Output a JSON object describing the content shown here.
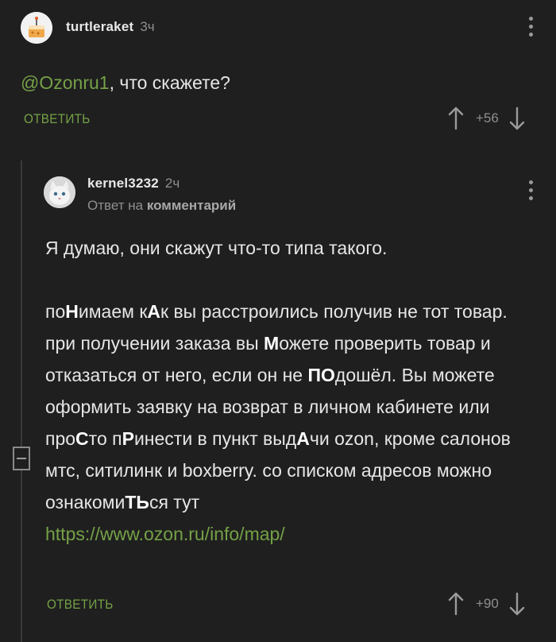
{
  "comment1": {
    "username": "turtleraket",
    "time": "3ч",
    "mention": "@Ozonru1",
    "text": ", что скажете?",
    "reply_label": "ОТВЕТИТЬ",
    "score": "+56",
    "avatar_icon": "cake-icon"
  },
  "comment2": {
    "username": "kernel3232",
    "time": "2ч",
    "reply_prefix": "Ответ на",
    "reply_target": "комментарий",
    "line1": "Я думаю, они скажут что-то типа такого.",
    "link": "https://www.ozon.ru/info/map/",
    "reply_label": "ОТВЕТИТЬ",
    "score": "+90",
    "avatar_icon": "cat-icon",
    "paragraph_segments": [
      "по",
      "Н",
      "имаем к",
      "А",
      "к вы расстроились получив не тот товар. при получении заказа вы ",
      "М",
      "ожете проверить товар и отказаться от него, если он не ",
      "ПО",
      "дошёл. Вы можете оформить заявку на возврат в личном кабинете или про",
      "С",
      "то п",
      "Р",
      "инести в пункт выд",
      "А",
      "чи ozon, кроме салонов мтс, ситилинк и boxberry. со списком адресов можно ознакоми",
      "ТЬ",
      "ся тут"
    ]
  },
  "colors": {
    "background": "#1f1f1f",
    "accent": "#75a147",
    "text": "#e6e6e6",
    "muted": "#8f8f8f"
  }
}
